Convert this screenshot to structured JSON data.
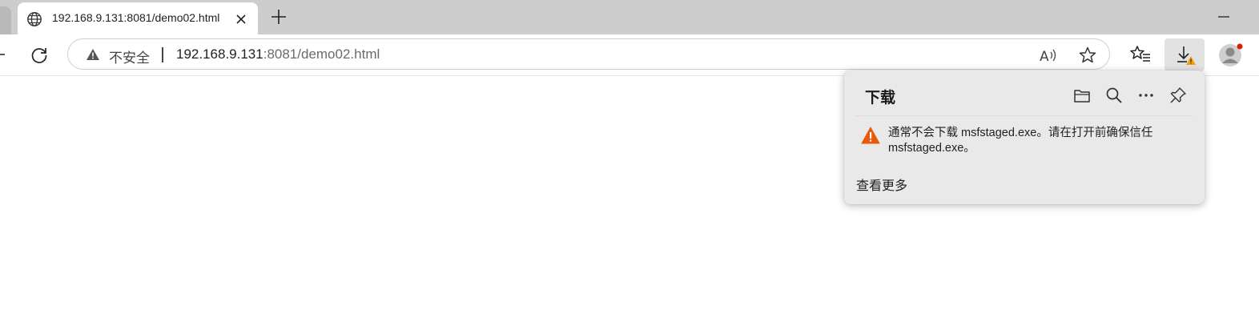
{
  "tab": {
    "title": "192.168.9.131:8081/demo02.html",
    "icon": "globe-icon"
  },
  "toolbar": {
    "security_label": "不安全",
    "security_separator": "|",
    "url_host": "192.168.9.131",
    "url_rest": ":8081/demo02.html"
  },
  "download_panel": {
    "title": "下载",
    "warning_text": "通常不会下载 msfstaged.exe。请在打开前确保信任 msfstaged.exe。",
    "see_more": "查看更多",
    "warning_color": "#e8590c"
  },
  "colors": {
    "tabstrip": "#cdcdcd",
    "flyout_bg": "#e9e9e9",
    "profile_badge": "#d81e06"
  }
}
